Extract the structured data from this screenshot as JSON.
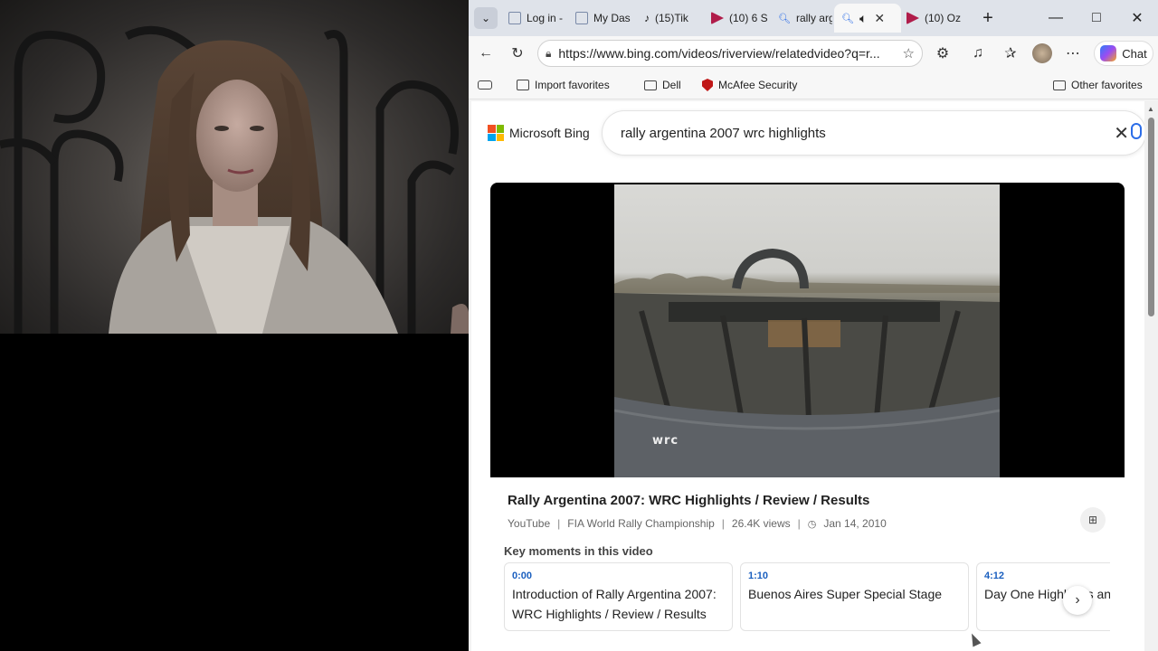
{
  "browser": {
    "tabs": [
      {
        "label": "Log in -",
        "favicon_color": "#7a8aa8"
      },
      {
        "label": "My Das",
        "favicon_color": "#7a8aa8"
      },
      {
        "label": "(15)Tik",
        "favicon_color": "#111111"
      },
      {
        "label": "(10) 6 S",
        "favicon_color": "#b01c4a"
      },
      {
        "label": "rally arg",
        "favicon_color": "#2b6de8"
      },
      {
        "label": "",
        "favicon_color": "#2b6de8",
        "active": true
      },
      {
        "label": "(10) Oz",
        "favicon_color": "#b01c4a"
      }
    ],
    "url": "https://www.bing.com/videos/riverview/relatedvideo?q=r...",
    "chat_label": "Chat",
    "favorites": {
      "import": "Import favorites",
      "dell": "Dell",
      "mcafee": "McAfee Security",
      "other": "Other favorites"
    }
  },
  "bing": {
    "brand": "Microsoft Bing",
    "query": "rally argentina 2007 wrc highlights"
  },
  "video": {
    "overlay_logo": "wrc",
    "title": "Rally Argentina 2007: WRC Highlights / Review / Results",
    "source": "YouTube",
    "channel": "FIA World Rally Championship",
    "views": "26.4K views",
    "date": "Jan 14, 2010",
    "key_moments_heading": "Key moments in this video",
    "key_moments": [
      {
        "time": "0:00",
        "text": "Introduction of Rally Argentina 2007: WRC Highlights / Review / Results"
      },
      {
        "time": "1:10",
        "text": "Buenos Aires Super Special Stage"
      },
      {
        "time": "4:12",
        "text": "Day One Highlights and"
      }
    ]
  },
  "colors": {
    "accent": "#2b6de8",
    "timestamp": "#1a5fbf",
    "ms_red": "#f25022",
    "ms_green": "#7fba00",
    "ms_blue": "#00a4ef",
    "ms_yellow": "#ffb900"
  }
}
